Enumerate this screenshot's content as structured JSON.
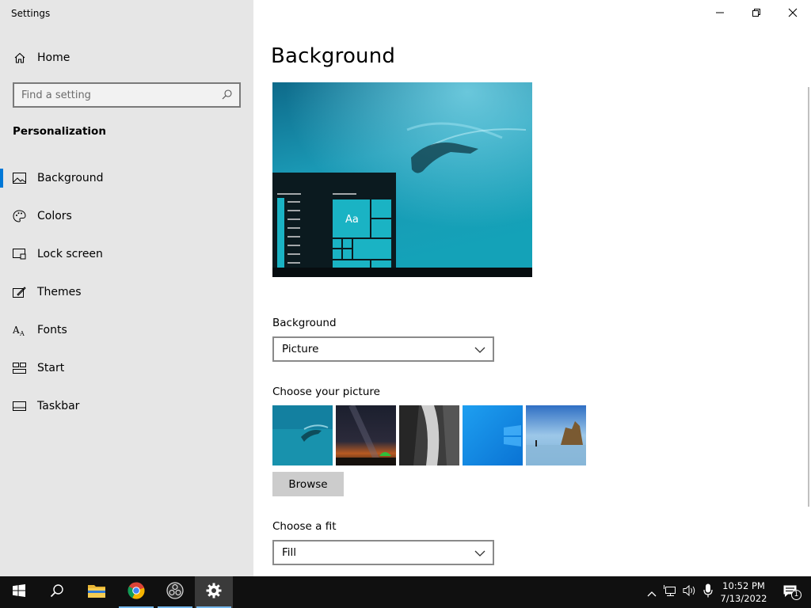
{
  "window": {
    "title": "Settings",
    "controls": {
      "minimize": "minimize",
      "maximize": "restore",
      "close": "close"
    }
  },
  "sidebar": {
    "home_label": "Home",
    "search_placeholder": "Find a setting",
    "section_title": "Personalization",
    "items": [
      {
        "label": "Background",
        "icon": "picture-icon",
        "active": true
      },
      {
        "label": "Colors",
        "icon": "palette-icon",
        "active": false
      },
      {
        "label": "Lock screen",
        "icon": "lock-screen-icon",
        "active": false
      },
      {
        "label": "Themes",
        "icon": "themes-icon",
        "active": false
      },
      {
        "label": "Fonts",
        "icon": "fonts-icon",
        "active": false
      },
      {
        "label": "Start",
        "icon": "start-icon",
        "active": false
      },
      {
        "label": "Taskbar",
        "icon": "taskbar-icon",
        "active": false
      }
    ]
  },
  "main": {
    "title": "Background",
    "preview": {
      "tile_label": "Aa"
    },
    "background": {
      "label": "Background",
      "value": "Picture"
    },
    "choose_picture": {
      "label": "Choose your picture",
      "browse_label": "Browse"
    },
    "fit": {
      "label": "Choose a fit",
      "value": "Fill"
    }
  },
  "taskbar": {
    "apps": [
      "start-icon",
      "search-icon",
      "file-explorer-icon",
      "chrome-icon",
      "obs-icon",
      "settings-icon"
    ],
    "time": "10:52 PM",
    "date": "7/13/2022",
    "notifications_count": "1"
  },
  "colors": {
    "accent": "#0078d7",
    "sidebar_bg": "#e6e6e6",
    "taskbar_bg": "#101010",
    "preview_tile": "#1ab3c4"
  }
}
